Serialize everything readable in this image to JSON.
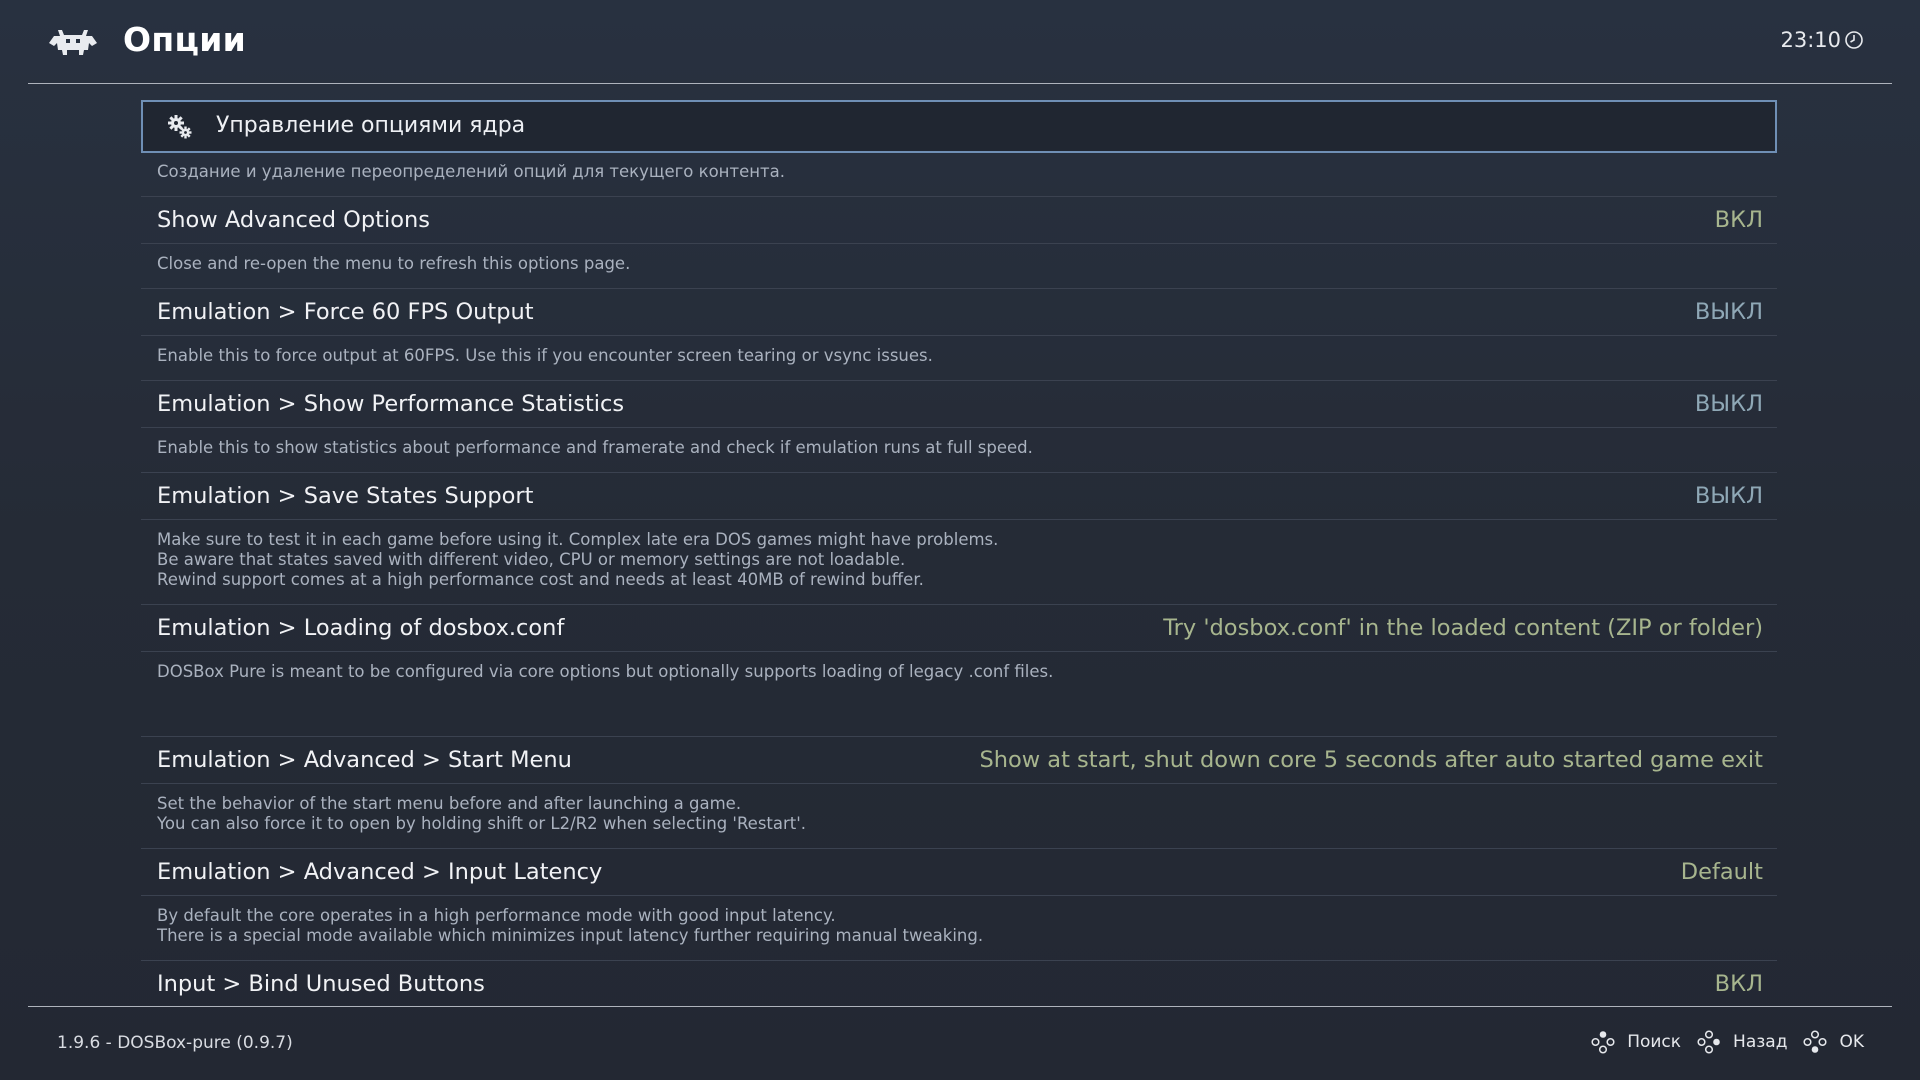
{
  "header": {
    "title": "Опции",
    "time": "23:10"
  },
  "core_options": {
    "label": "Управление опциями ядра",
    "description": "Создание и удаление переопределений опций для текущего контента."
  },
  "items": [
    {
      "label": "Show Advanced Options",
      "value": "ВКЛ",
      "description": "Close and re-open the menu to refresh this options page."
    },
    {
      "label": "Emulation > Force 60 FPS Output",
      "value": "ВЫКЛ",
      "description": "Enable this to force output at 60FPS. Use this if you encounter screen tearing or vsync issues."
    },
    {
      "label": "Emulation > Show Performance Statistics",
      "value": "ВЫКЛ",
      "description": "Enable this to show statistics about performance and framerate and check if emulation runs at full speed."
    },
    {
      "label": "Emulation > Save States Support",
      "value": "ВЫКЛ",
      "description": "Make sure to test it in each game before using it. Complex late era DOS games might have problems.\nBe aware that states saved with different video, CPU or memory settings are not loadable.\nRewind support comes at a high performance cost and needs at least 40MB of rewind buffer."
    },
    {
      "label": "Emulation > Loading of dosbox.conf",
      "value": "Try 'dosbox.conf' in the loaded content (ZIP or folder)",
      "description": "DOSBox Pure is meant to be configured via core options but optionally supports loading of legacy .conf files."
    },
    {
      "label": "Emulation > Advanced > Start Menu",
      "value": "Show at start, shut down core 5 seconds after auto started game exit",
      "description": "Set the behavior of the start menu before and after launching a game.\nYou can also force it to open by holding shift or L2/R2 when selecting 'Restart'."
    },
    {
      "label": "Emulation > Advanced > Input Latency",
      "value": "Default",
      "description": "By default the core operates in a high performance mode with good input latency.\nThere is a special mode available which minimizes input latency further requiring manual tweaking."
    },
    {
      "label": "Input > Bind Unused Buttons",
      "value": "ВКЛ",
      "description": ""
    }
  ],
  "footer": {
    "version": "1.9.6 - DOSBox-pure (0.9.7)",
    "search_label": "Поиск",
    "back_label": "Назад",
    "ok_label": "OK"
  },
  "colors": {
    "accent_border": "#6f8fb5",
    "value_on": "#a7b58e",
    "value_off": "#8fa8b6"
  }
}
